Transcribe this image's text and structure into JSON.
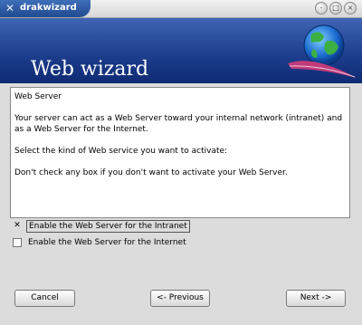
{
  "window": {
    "title": "drakwizard",
    "buttons": {
      "minimize": "-",
      "maximize": "□",
      "close": "×"
    }
  },
  "banner": {
    "title": "Web wizard"
  },
  "info": {
    "heading": "Web Server",
    "para1": "Your server can act as a Web Server toward your internal network (intranet) and as a Web Server for the Internet.",
    "para2": "Select the kind of Web service you want to activate:",
    "para3": "Don't check any box if you don't want to activate your Web Server."
  },
  "options": [
    {
      "label": "Enable the Web Server for the Intranet",
      "checked": true
    },
    {
      "label": "Enable the Web Server for the Internet",
      "checked": false
    }
  ],
  "buttons": {
    "cancel": "Cancel",
    "previous": "<- Previous",
    "next": "Next ->"
  },
  "colors": {
    "banner": "#1d3f8f",
    "titleTab": "#2c5aa0"
  }
}
